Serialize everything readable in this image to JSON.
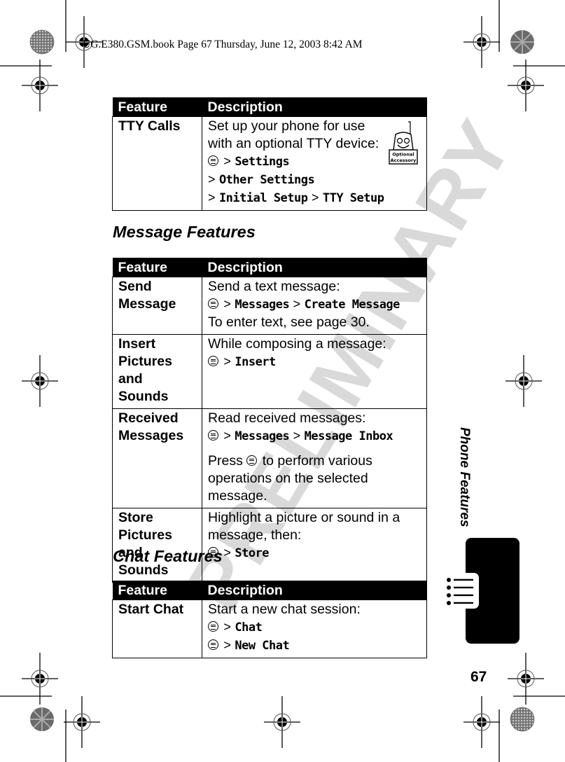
{
  "header": {
    "print_info": "UG.E380.GSM.book  Page 67  Thursday, June 12, 2003  8:42 AM"
  },
  "watermark": "PRELIMINARY",
  "icons": {
    "menu_key": "menu-key-icon",
    "separator": ">"
  },
  "tables": {
    "top": {
      "headers": [
        "Feature",
        "Description"
      ],
      "rows": [
        {
          "feature": "TTY Calls",
          "text_lines": [
            "Set up your phone for use",
            "with an optional TTY device:"
          ],
          "path_lines": [
            [
              "Settings"
            ],
            [
              "Other Settings"
            ],
            [
              "Initial Setup",
              "TTY Setup"
            ]
          ],
          "badge": {
            "line1": "Optional",
            "line2": "Accessory"
          }
        }
      ]
    },
    "message": {
      "title": "Message Features",
      "headers": [
        "Feature",
        "Description"
      ],
      "rows": [
        {
          "feature": "Send Message",
          "intro": "Send a text message:",
          "path": [
            "Messages",
            "Create Message"
          ],
          "note": "To enter text, see page 30."
        },
        {
          "feature": "Insert Pictures and Sounds",
          "intro": "While composing a message:",
          "path": [
            "Insert"
          ]
        },
        {
          "feature": "Received Messages",
          "intro": "Read received messages:",
          "path": [
            "Messages",
            "Message Inbox"
          ],
          "note_before": "Press",
          "note_after": "to perform various operations on the selected message."
        },
        {
          "feature": "Store Pictures and Sounds",
          "intro": "Highlight a picture or sound in a message, then:",
          "path": [
            "Store"
          ]
        }
      ]
    },
    "chat": {
      "title": "Chat Features",
      "headers": [
        "Feature",
        "Description"
      ],
      "rows": [
        {
          "feature": "Start Chat",
          "intro": "Start a new chat session:",
          "path1": [
            "Chat"
          ],
          "path2": [
            "New Chat"
          ]
        }
      ]
    }
  },
  "side_tab": {
    "label": "Phone Features",
    "icon": "list-bullets-icon"
  },
  "page_number": "67"
}
